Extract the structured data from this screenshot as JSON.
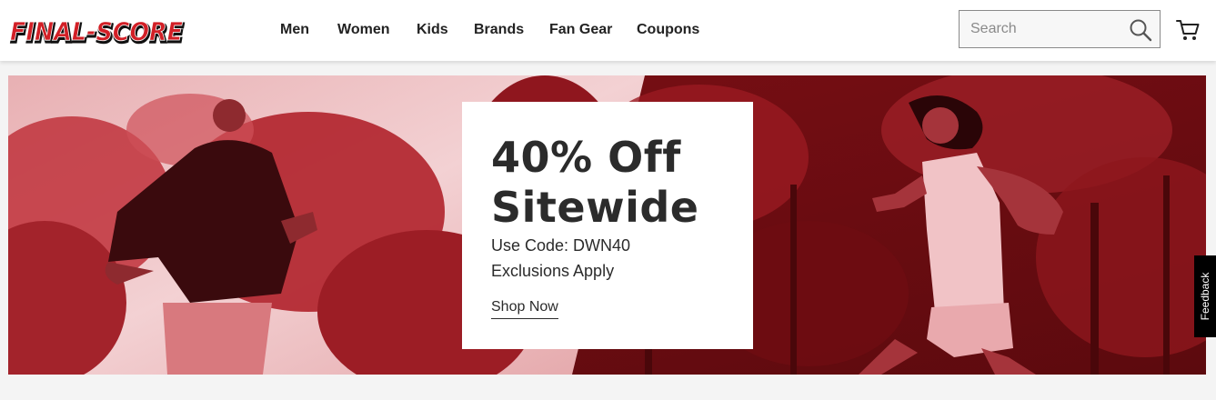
{
  "header": {
    "logo_text": "FINAL-SCORE",
    "nav": [
      "Men",
      "Women",
      "Kids",
      "Brands",
      "Fan Gear",
      "Coupons"
    ],
    "search": {
      "placeholder": "Search"
    }
  },
  "hero": {
    "title_line1": "40% Off",
    "title_line2": "Sitewide",
    "code_line": "Use Code: DWN40",
    "exclusions": "Exclusions Apply",
    "cta": "Shop Now"
  },
  "feedback_label": "Feedback",
  "colors": {
    "brand_red": "#d21f26",
    "hero_dark": "#7a0f14",
    "text_dark": "#2b2b2b"
  }
}
